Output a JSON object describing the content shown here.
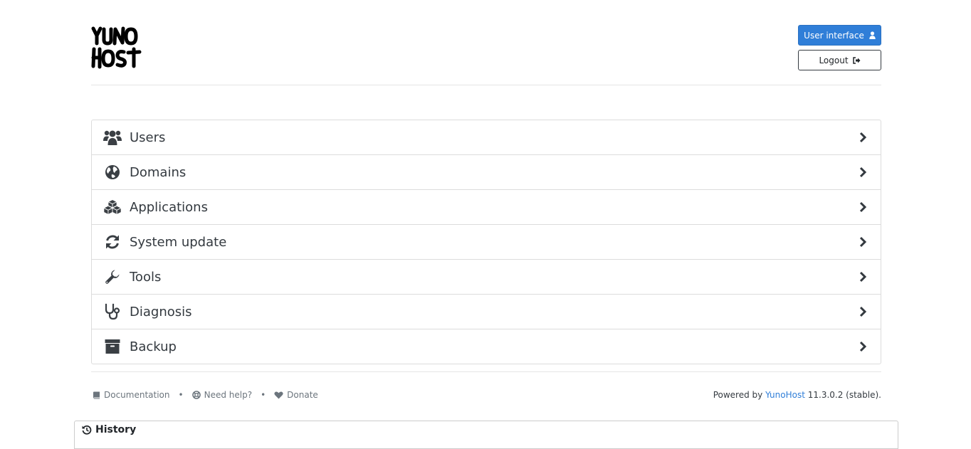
{
  "header": {
    "logo_alt": "YunoHost",
    "user_interface_label": "User interface",
    "logout_label": "Logout"
  },
  "menu": {
    "items": [
      {
        "label": "Users",
        "icon": "users-icon"
      },
      {
        "label": "Domains",
        "icon": "globe-icon"
      },
      {
        "label": "Applications",
        "icon": "cubes-icon"
      },
      {
        "label": "System update",
        "icon": "refresh-icon"
      },
      {
        "label": "Tools",
        "icon": "wrench-icon"
      },
      {
        "label": "Diagnosis",
        "icon": "stethoscope-icon"
      },
      {
        "label": "Backup",
        "icon": "archive-icon"
      }
    ]
  },
  "footer": {
    "documentation": "Documentation",
    "need_help": "Need help?",
    "donate": "Donate",
    "separator": "•",
    "powered_prefix": "Powered by",
    "brand": "YunoHost",
    "version": "11.3.0.2 (stable)."
  },
  "history": {
    "title": "History"
  },
  "colors": {
    "primary": "#2f7ed8",
    "text": "#33393f",
    "muted": "#6c757d"
  }
}
